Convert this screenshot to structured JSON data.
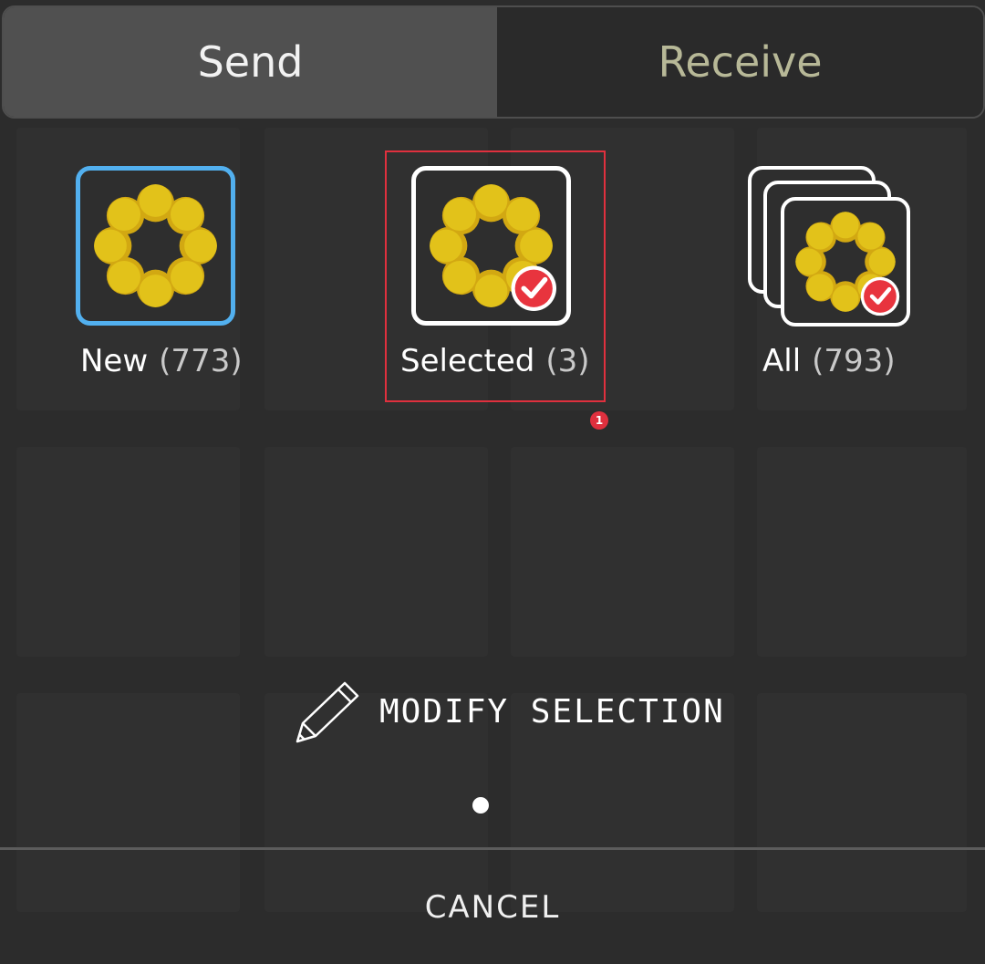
{
  "tabs": [
    {
      "label": "Send",
      "active": true
    },
    {
      "label": "Receive",
      "active": false
    }
  ],
  "options": {
    "new": {
      "label": "New",
      "count": "(773)",
      "icon": "sunflower-icon"
    },
    "selected": {
      "label": "Selected",
      "count": "(3)",
      "icon": "sunflower-check-icon"
    },
    "all": {
      "label": "All",
      "count": "(793)",
      "icon": "sunflower-stack-check-icon"
    }
  },
  "annotation": {
    "marker": "1"
  },
  "modify": {
    "label": "MODIFY SELECTION",
    "icon": "pencil-icon"
  },
  "cancel": {
    "label": "CANCEL"
  },
  "colors": {
    "accent_border": "#52b0ef",
    "highlight": "#e0303e",
    "petal": "#e2c21a",
    "check": "#e8343e"
  }
}
